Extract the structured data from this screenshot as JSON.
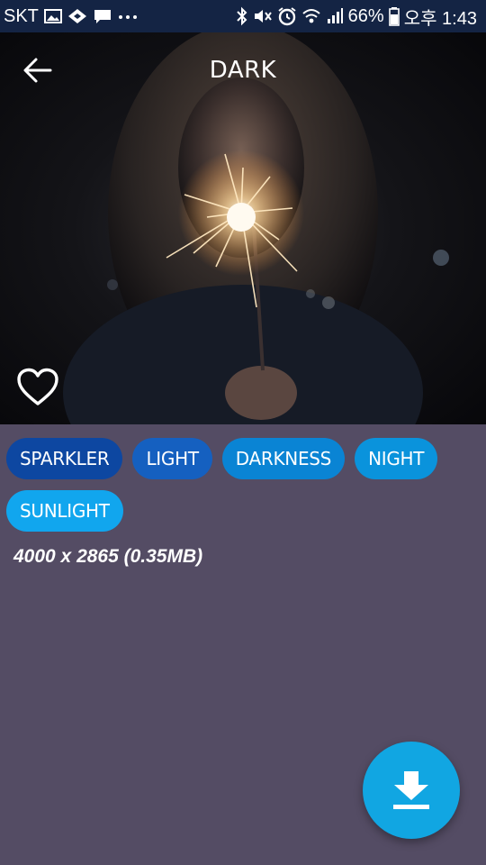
{
  "status_bar": {
    "carrier": "SKT",
    "battery": "66%",
    "time": "오후 1:43",
    "left_icons": [
      "image-icon",
      "app-notification-icon",
      "message-icon",
      "more-dots-icon"
    ],
    "right_icons": [
      "bluetooth-icon",
      "mute-icon",
      "alarm-icon",
      "wifi-icon",
      "signal-icon",
      "battery-icon"
    ]
  },
  "header": {
    "title": "DARK",
    "back_icon": "arrow-left-icon"
  },
  "photo": {
    "favorite_icon": "heart-outline-icon"
  },
  "tags": [
    {
      "label": "SPARKLER",
      "color": "#0d47a1"
    },
    {
      "label": "LIGHT",
      "color": "#1560c0"
    },
    {
      "label": "DARKNESS",
      "color": "#0a84d4"
    },
    {
      "label": "NIGHT",
      "color": "#0a93dc"
    },
    {
      "label": "SUNLIGHT",
      "color": "#11a6ee"
    }
  ],
  "image_info": "4000 x 2865 (0.35MB)",
  "fab": {
    "icon": "download-icon",
    "color": "#11a6e2"
  }
}
